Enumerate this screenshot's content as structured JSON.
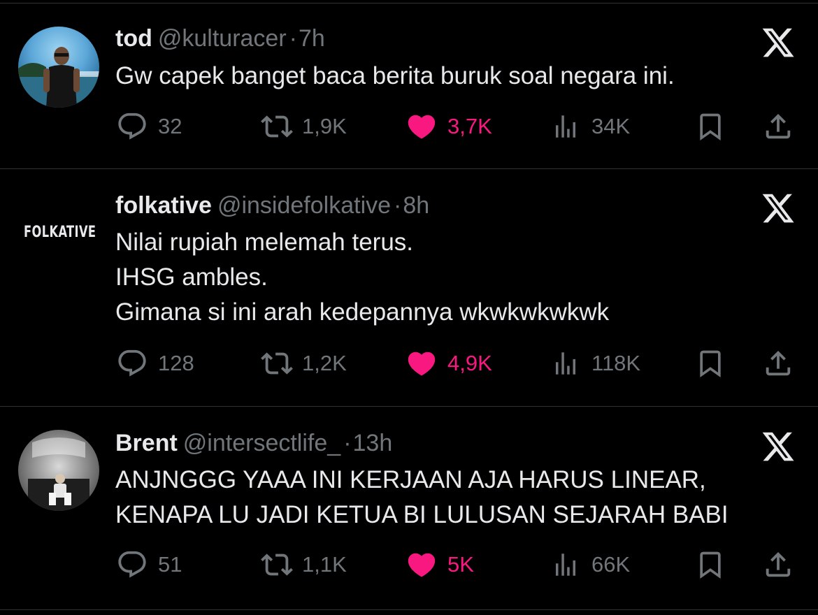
{
  "tweets": [
    {
      "name": "tod",
      "handle": "@kulturacer",
      "separator": "·",
      "time": "7h",
      "lines": [
        "Gw capek banget baca berita buruk soal negara ini."
      ],
      "replies": "32",
      "retweets": "1,9K",
      "likes": "3,7K",
      "views": "34K",
      "avatar": "photo-avatar"
    },
    {
      "name": "folkative",
      "handle": "@insidefolkative",
      "separator": "·",
      "time": "8h",
      "lines": [
        "Nilai rupiah melemah terus.",
        "IHSG ambles.",
        "Gimana si ini arah kedepannya wkwkwkwkwk"
      ],
      "replies": "128",
      "retweets": "1,2K",
      "likes": "4,9K",
      "views": "118K",
      "avatar_text": "FOLKATIVE"
    },
    {
      "name": "Brent",
      "handle": "@intersectlife_",
      "separator": "·",
      "time": "13h",
      "lines": [
        "ANJNGGG YAAA INI KERJAAN AJA HARUS LINEAR,",
        "KENAPA LU JADI KETUA BI LULUSAN SEJARAH BABI"
      ],
      "replies": "51",
      "retweets": "1,1K",
      "likes": "5K",
      "views": "66K",
      "avatar": "photo-avatar"
    }
  ],
  "colors": {
    "background": "#000000",
    "text": "#e7e9ea",
    "muted": "#71767b",
    "like": "#f91880",
    "divider": "#2f3336"
  },
  "icons": [
    "reply-icon",
    "retweet-icon",
    "like-icon",
    "views-icon",
    "bookmark-icon",
    "share-icon",
    "x-logo-icon"
  ]
}
